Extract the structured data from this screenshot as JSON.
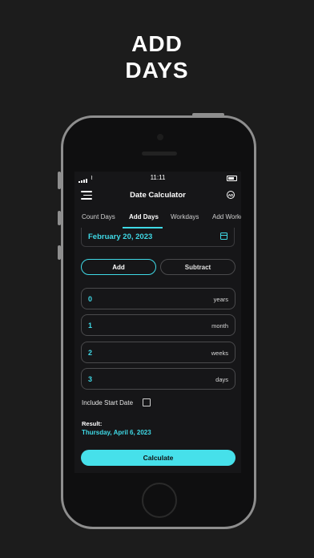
{
  "promo": {
    "line1": "ADD",
    "line2": "DAYS"
  },
  "status_bar": {
    "time": "11:11"
  },
  "app": {
    "title": "Date Calculator",
    "ad_icon_label": "AD"
  },
  "tabs": [
    {
      "label": "Count Days",
      "active": false
    },
    {
      "label": "Add Days",
      "active": true
    },
    {
      "label": "Workdays",
      "active": false
    },
    {
      "label": "Add Workd",
      "active": false
    }
  ],
  "date_field": {
    "value": "February 20, 2023",
    "icon": "calendar-icon"
  },
  "mode": {
    "add_label": "Add",
    "subtract_label": "Subtract",
    "selected": "Add"
  },
  "fields": [
    {
      "value": "0",
      "unit": "years"
    },
    {
      "value": "1",
      "unit": "month"
    },
    {
      "value": "2",
      "unit": "weeks"
    },
    {
      "value": "3",
      "unit": "days"
    }
  ],
  "include_start_date": {
    "label": "Include Start Date",
    "checked": false
  },
  "result": {
    "label": "Result:",
    "value": "Thursday, April 6, 2023"
  },
  "calculate_label": "Calculate",
  "colors": {
    "accent": "#3fd9e6",
    "background": "#1c1c1c",
    "screen": "#161618"
  }
}
